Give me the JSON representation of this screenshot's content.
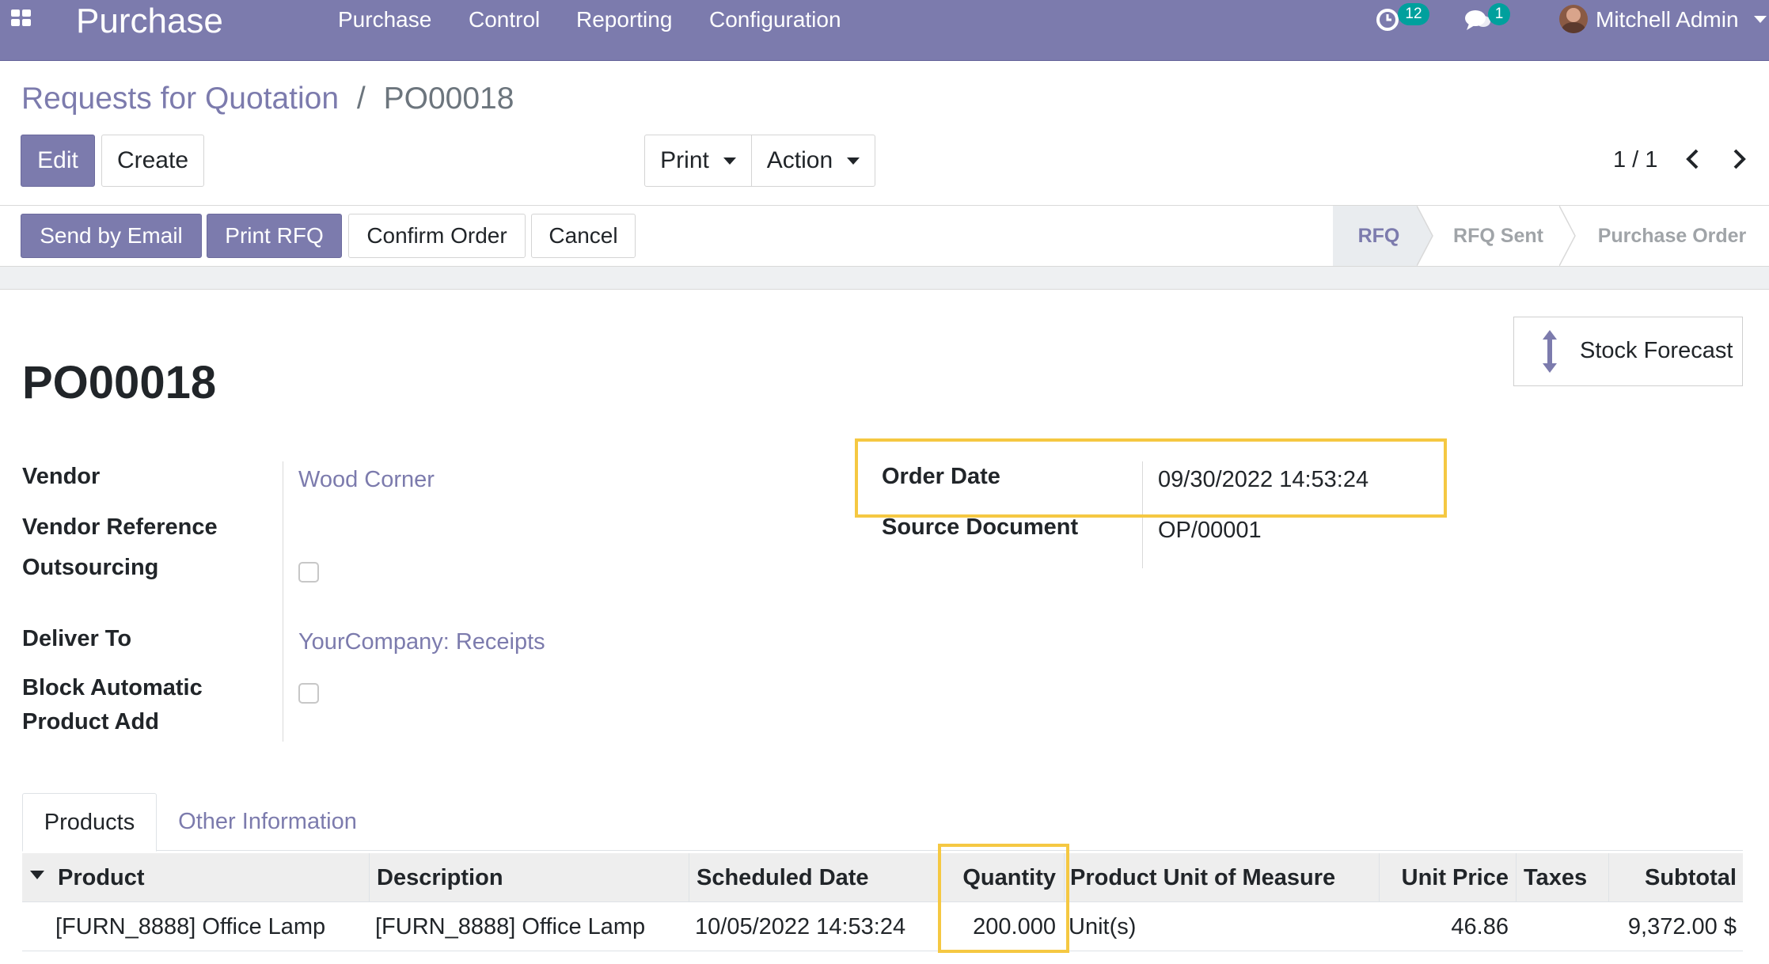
{
  "navbar": {
    "app_title": "Purchase",
    "menu": [
      "Purchase",
      "Control",
      "Reporting",
      "Configuration"
    ],
    "activity_count": "12",
    "message_count": "1",
    "user_name": "Mitchell Admin"
  },
  "breadcrumb": {
    "parent": "Requests for Quotation",
    "separator": "/",
    "current": "PO00018"
  },
  "control_panel": {
    "edit_label": "Edit",
    "create_label": "Create",
    "print_label": "Print",
    "action_label": "Action",
    "pager": "1 / 1"
  },
  "statusbar": {
    "buttons": [
      "Send by Email",
      "Print RFQ",
      "Confirm Order",
      "Cancel"
    ],
    "stages": [
      "RFQ",
      "RFQ Sent",
      "Purchase Order"
    ],
    "active_stage": "RFQ"
  },
  "smart_button": {
    "label": "Stock Forecast",
    "icon": "arrows-v-icon"
  },
  "form": {
    "title": "PO00018",
    "left": {
      "vendor_label": "Vendor",
      "vendor_value": "Wood Corner",
      "vendor_ref_label": "Vendor Reference",
      "outsourcing_label": "Outsourcing",
      "deliver_to_label": "Deliver To",
      "deliver_to_value": "YourCompany: Receipts",
      "block_label_1": "Block Automatic",
      "block_label_2": "Product Add"
    },
    "right": {
      "order_date_label": "Order Date",
      "order_date_value": "09/30/2022 14:53:24",
      "source_doc_label": "Source Document",
      "source_doc_value": "OP/00001"
    }
  },
  "tabs": [
    "Products",
    "Other Information"
  ],
  "order_lines": {
    "columns": [
      "Product",
      "Description",
      "Scheduled Date",
      "Quantity",
      "Product Unit of Measure",
      "Unit Price",
      "Taxes",
      "Subtotal"
    ],
    "rows": [
      {
        "product": "[FURN_8888] Office Lamp",
        "description": "[FURN_8888] Office Lamp",
        "scheduled_date": "10/05/2022 14:53:24",
        "quantity": "200.000",
        "uom": "Unit(s)",
        "unit_price": "46.86",
        "taxes": "",
        "subtotal": "9,372.00 $"
      }
    ]
  },
  "colors": {
    "brand": "#7c7bad",
    "badge": "#00a09d",
    "highlight": "#f5c842"
  }
}
